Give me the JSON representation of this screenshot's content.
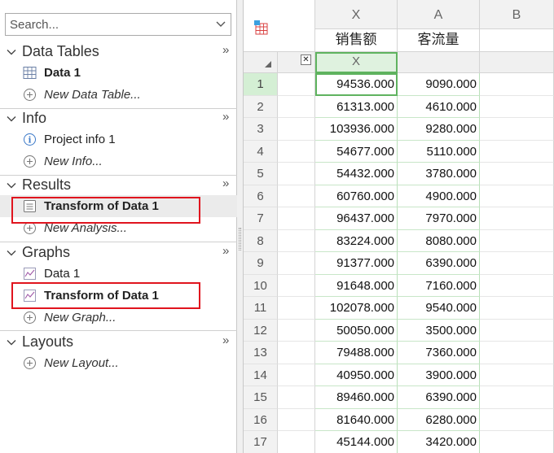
{
  "search": {
    "placeholder": "Search..."
  },
  "nav": {
    "more_glyph": "»",
    "sections": [
      {
        "title": "Data Tables",
        "items": [
          {
            "label": "Data 1",
            "icon": "data-table-icon",
            "style": "bold"
          },
          {
            "label": "New Data Table...",
            "icon": "add-icon",
            "style": "italic"
          }
        ]
      },
      {
        "title": "Info",
        "items": [
          {
            "label": "Project info 1",
            "icon": "info-icon",
            "style": "normal"
          },
          {
            "label": "New Info...",
            "icon": "add-icon",
            "style": "italic"
          }
        ]
      },
      {
        "title": "Results",
        "items": [
          {
            "label": "Transform of Data 1",
            "icon": "results-sheet-icon",
            "style": "bold",
            "selected": true,
            "highlighted": true
          },
          {
            "label": "New Analysis...",
            "icon": "add-icon",
            "style": "italic"
          }
        ]
      },
      {
        "title": "Graphs",
        "items": [
          {
            "label": "Data 1",
            "icon": "graph-icon",
            "style": "normal"
          },
          {
            "label": "Transform of Data 1",
            "icon": "graph-icon",
            "style": "bold",
            "highlighted": true
          },
          {
            "label": "New Graph...",
            "icon": "add-icon",
            "style": "italic"
          }
        ]
      },
      {
        "title": "Layouts",
        "items": [
          {
            "label": "New Layout...",
            "icon": "add-icon",
            "style": "italic"
          }
        ]
      }
    ]
  },
  "grid": {
    "corner_icon": "table-format-icon",
    "close_glyph": "✕",
    "columns": [
      {
        "letter": "X",
        "title": "销售额",
        "subheader": "X"
      },
      {
        "letter": "A",
        "title": "客流量",
        "subheader": ""
      },
      {
        "letter": "B",
        "title": "",
        "subheader": ""
      }
    ],
    "rows": [
      {
        "num": "1",
        "x": "94536.000",
        "a": "9090.000"
      },
      {
        "num": "2",
        "x": "61313.000",
        "a": "4610.000"
      },
      {
        "num": "3",
        "x": "103936.000",
        "a": "9280.000"
      },
      {
        "num": "4",
        "x": "54677.000",
        "a": "5110.000"
      },
      {
        "num": "5",
        "x": "54432.000",
        "a": "3780.000"
      },
      {
        "num": "6",
        "x": "60760.000",
        "a": "4900.000"
      },
      {
        "num": "7",
        "x": "96437.000",
        "a": "7970.000"
      },
      {
        "num": "8",
        "x": "83224.000",
        "a": "8080.000"
      },
      {
        "num": "9",
        "x": "91377.000",
        "a": "6390.000"
      },
      {
        "num": "10",
        "x": "91648.000",
        "a": "7160.000"
      },
      {
        "num": "11",
        "x": "102078.000",
        "a": "9540.000"
      },
      {
        "num": "12",
        "x": "50050.000",
        "a": "3500.000"
      },
      {
        "num": "13",
        "x": "79488.000",
        "a": "7360.000"
      },
      {
        "num": "14",
        "x": "40950.000",
        "a": "3900.000"
      },
      {
        "num": "15",
        "x": "89460.000",
        "a": "6390.000"
      },
      {
        "num": "16",
        "x": "81640.000",
        "a": "6280.000"
      },
      {
        "num": "17",
        "x": "45144.000",
        "a": "3420.000"
      }
    ],
    "active_row": "1"
  },
  "colors": {
    "highlight_box": "#e0141e",
    "selection_green": "#5fb35f",
    "active_row_bg": "#d4efd4"
  }
}
